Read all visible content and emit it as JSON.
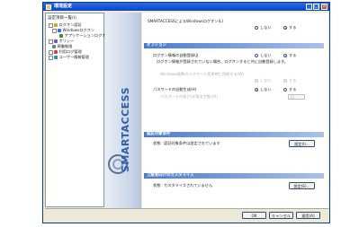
{
  "window": {
    "title": "環境設定",
    "min": "_",
    "max": "□",
    "close": "×"
  },
  "tree": {
    "header": "設定項目一覧(I)",
    "items": [
      {
        "label": "ログオン認証",
        "expander": "-",
        "icon_color": "#d3a521"
      },
      {
        "label": "Windowsログオン",
        "expander": "-",
        "icon_color": "#3b6fd1"
      },
      {
        "label": "アプリケーションログオン",
        "expander": "",
        "icon_color": "#4c8a3a"
      },
      {
        "label": "ポリシー",
        "expander": "+",
        "icon_color": "#7a5aa8"
      },
      {
        "label": "稼働制限",
        "expander": "",
        "icon_color": "#7f7f7f"
      },
      {
        "label": "利用ログ管理",
        "expander": "+",
        "icon_color": "#c74a3a"
      },
      {
        "label": "ユーザー情報管理",
        "expander": "+",
        "icon_color": "#2f8bb3"
      }
    ]
  },
  "banner": {
    "text": "SMARTACCESS"
  },
  "panel": {
    "top": {
      "question": "SMARTACCESSによるWindowsログオン(L)",
      "opt_no": "しない",
      "opt_yes": "する",
      "selected": "yes"
    },
    "options": {
      "header": "オプション",
      "autologon": {
        "label": "ログオン情報の自動登録(J)",
        "opt_no": "しない",
        "opt_yes": "する",
        "selected": "yes",
        "note": "ログオン情報が登録されていない場合、ログオンすると共に自動登録します。"
      },
      "windows_sync": {
        "label": "Windows標準のパスワード変更時に同期する(W)",
        "opt_no": "しない",
        "opt_yes": "する"
      },
      "password_auto": {
        "label": "パスワードの自動生成(H)",
        "opt_no": "しない",
        "opt_yes": "する",
        "selected": "no"
      },
      "length": {
        "label": "パスワードの長さ(半角文字数)(R)",
        "value": "12"
      }
    },
    "auth": {
      "header": "認証対象条件",
      "status_label": "状態:",
      "status_text": "認証対象条件は設定されています",
      "button": "設定(I)..."
    },
    "custom": {
      "header": "上級者向けのカスタマイズ",
      "status_label": "状態:",
      "status_text": "カスタマイズされていません",
      "button": "設定(E)..."
    }
  },
  "footer": {
    "ok": "OK",
    "cancel": "キャンセル",
    "apply": "適用(A)"
  }
}
